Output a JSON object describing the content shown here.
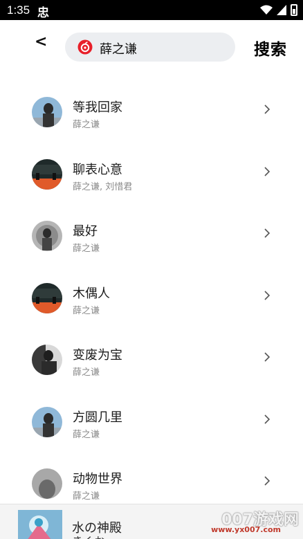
{
  "status_bar": {
    "time": "1:35",
    "app_glyph": "忠"
  },
  "header": {
    "back_label": "<",
    "search_value": "薛之谦",
    "search_button_label": "搜索"
  },
  "songs": [
    {
      "title": "等我回家",
      "artist": "薛之谦"
    },
    {
      "title": "聊表心意",
      "artist": "薛之谦, 刘惜君"
    },
    {
      "title": "最好",
      "artist": "薛之谦"
    },
    {
      "title": "木偶人",
      "artist": "薛之谦"
    },
    {
      "title": "变废为宝",
      "artist": "薛之谦"
    },
    {
      "title": "方圆几里",
      "artist": "薛之谦"
    },
    {
      "title": "动物世界",
      "artist": "薛之谦"
    }
  ],
  "mini_player": {
    "title": "水の神殿",
    "subtitle": "きくお"
  },
  "watermark": {
    "text": "007游戏网",
    "url": "www.yx007.com"
  },
  "colors": {
    "accent": "#e8202a",
    "search_bg": "#eceef1",
    "artist_gray": "#8a8a8a"
  }
}
